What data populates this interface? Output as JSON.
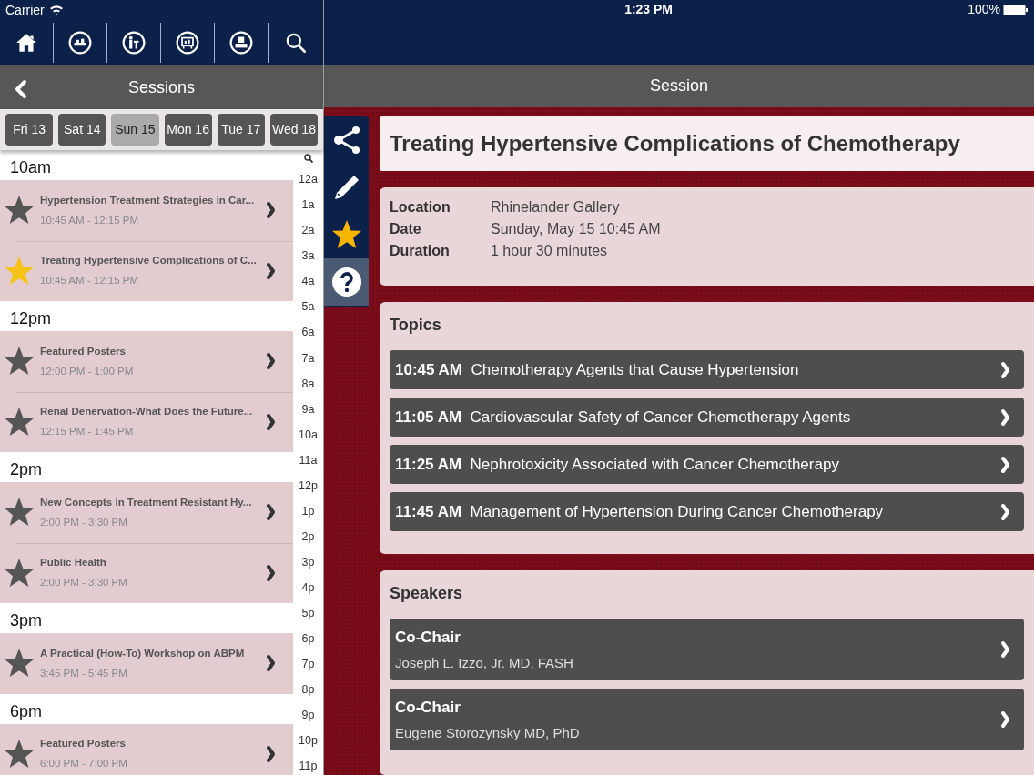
{
  "status_bar": {
    "carrier": "Carrier",
    "time": "1:23 PM",
    "battery": "100%"
  },
  "left_header": {
    "title": "Sessions"
  },
  "days": [
    {
      "label": "Fri 13",
      "selected": false
    },
    {
      "label": "Sat 14",
      "selected": false
    },
    {
      "label": "Sun 15",
      "selected": true
    },
    {
      "label": "Mon 16",
      "selected": false
    },
    {
      "label": "Tue 17",
      "selected": false
    },
    {
      "label": "Wed 18",
      "selected": false
    }
  ],
  "session_groups": [
    {
      "hour": "10am",
      "sessions": [
        {
          "title": "Hypertension Treatment Strategies in Car...",
          "time": "10:45 AM - 12:15 PM",
          "starred": false
        },
        {
          "title": "Treating Hypertensive Complications of C...",
          "time": "10:45 AM - 12:15 PM",
          "starred": true
        }
      ]
    },
    {
      "hour": "12pm",
      "sessions": [
        {
          "title": "Featured Posters",
          "time": "12:00 PM - 1:00 PM",
          "starred": false
        },
        {
          "title": "Renal Denervation-What Does the Future...",
          "time": "12:15 PM - 1:45 PM",
          "starred": false
        }
      ]
    },
    {
      "hour": "2pm",
      "sessions": [
        {
          "title": "New Concepts in Treatment Resistant Hy...",
          "time": "2:00 PM - 3:30 PM",
          "starred": false
        },
        {
          "title": "Public Health",
          "time": "2:00 PM - 3:30 PM",
          "starred": false
        }
      ]
    },
    {
      "hour": "3pm",
      "sessions": [
        {
          "title": "A Practical (How-To) Workshop on ABPM",
          "time": "3:45 PM - 5:45 PM",
          "starred": false
        }
      ]
    },
    {
      "hour": "6pm",
      "sessions": [
        {
          "title": "Featured Posters",
          "time": "6:00 PM - 7:00 PM",
          "starred": false
        }
      ]
    }
  ],
  "hour_index": [
    "12a",
    "1a",
    "2a",
    "3a",
    "4a",
    "5a",
    "6a",
    "7a",
    "8a",
    "9a",
    "10a",
    "11a",
    "12p",
    "1p",
    "2p",
    "3p",
    "4p",
    "5p",
    "6p",
    "7p",
    "8p",
    "9p",
    "10p",
    "11p"
  ],
  "right_header": {
    "title": "Session"
  },
  "toolbar": {
    "starred": true
  },
  "detail": {
    "title": "Treating Hypertensive Complications of Chemotherapy",
    "info": [
      {
        "label": "Location",
        "value": "Rhinelander Gallery"
      },
      {
        "label": "Date",
        "value": "Sunday, May 15 10:45 AM"
      },
      {
        "label": "Duration",
        "value": "1 hour 30 minutes"
      }
    ],
    "topics": {
      "heading": "Topics",
      "items": [
        {
          "time": "10:45 AM",
          "title": "Chemotherapy Agents that Cause Hypertension"
        },
        {
          "time": "11:05 AM",
          "title": "Cardiovascular Safety of Cancer Chemotherapy Agents"
        },
        {
          "time": "11:25 AM",
          "title": "Nephrotoxicity Associated with Cancer Chemotherapy"
        },
        {
          "time": "11:45 AM",
          "title": "Management of Hypertension During Cancer Chemotherapy"
        }
      ]
    },
    "speakers": {
      "heading": "Speakers",
      "items": [
        {
          "role": "Co-Chair",
          "name": "Joseph L. Izzo, Jr. MD, FASH"
        },
        {
          "role": "Co-Chair",
          "name": "Eugene Storozynsky MD, PhD"
        }
      ]
    }
  }
}
